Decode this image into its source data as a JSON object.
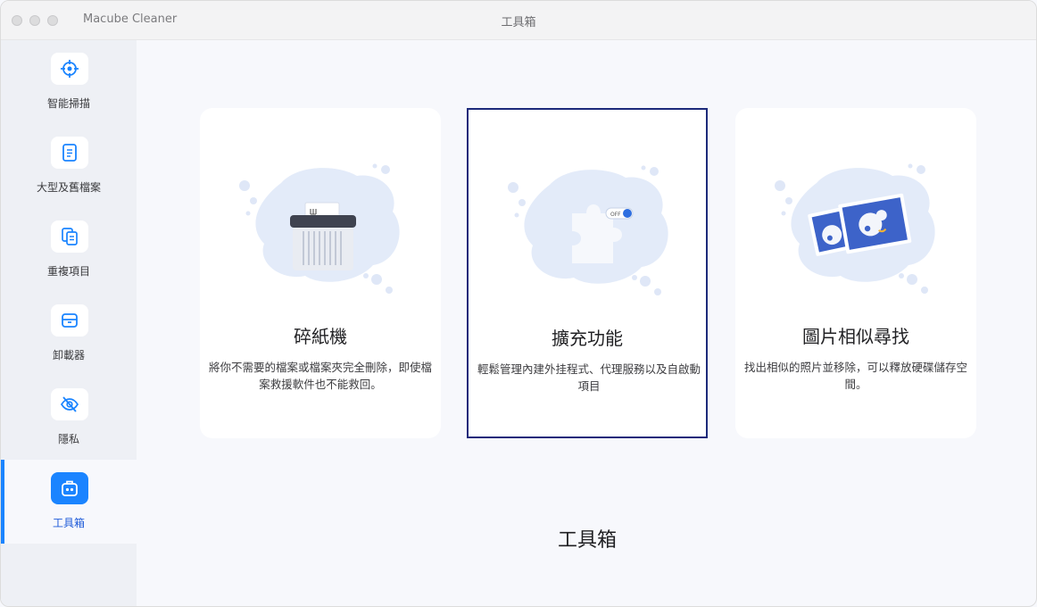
{
  "titlebar": {
    "app_name": "Macube Cleaner",
    "title": "工具箱"
  },
  "sidebar": {
    "items": [
      {
        "label": "智能掃描",
        "icon": "target-icon"
      },
      {
        "label": "大型及舊檔案",
        "icon": "file-icon"
      },
      {
        "label": "重複項目",
        "icon": "duplicate-files-icon"
      },
      {
        "label": "卸載器",
        "icon": "box-icon"
      },
      {
        "label": "隱私",
        "icon": "eye-off-icon"
      },
      {
        "label": "工具箱",
        "icon": "toolbox-icon",
        "active": true
      }
    ]
  },
  "main": {
    "cards": [
      {
        "title": "碎紙機",
        "description": "將你不需要的檔案或檔案夾完全刪除，即使檔案救援軟件也不能救回。",
        "icon": "shredder-illustration"
      },
      {
        "title": "擴充功能",
        "description": "輕鬆管理內建外挂程式、代理服務以及自啟動項目",
        "icon": "puzzle-toggle-illustration",
        "toggle_text": "OFF",
        "selected": true
      },
      {
        "title": "圖片相似尋找",
        "description": "找出相似的照片並移除，可以釋放硬碟儲存空間。",
        "icon": "photos-illustration"
      }
    ],
    "section_title": "工具箱"
  },
  "colors": {
    "accent": "#1a84ff",
    "selected_border": "#1d2a7a",
    "blob": "#e3ebf9"
  }
}
